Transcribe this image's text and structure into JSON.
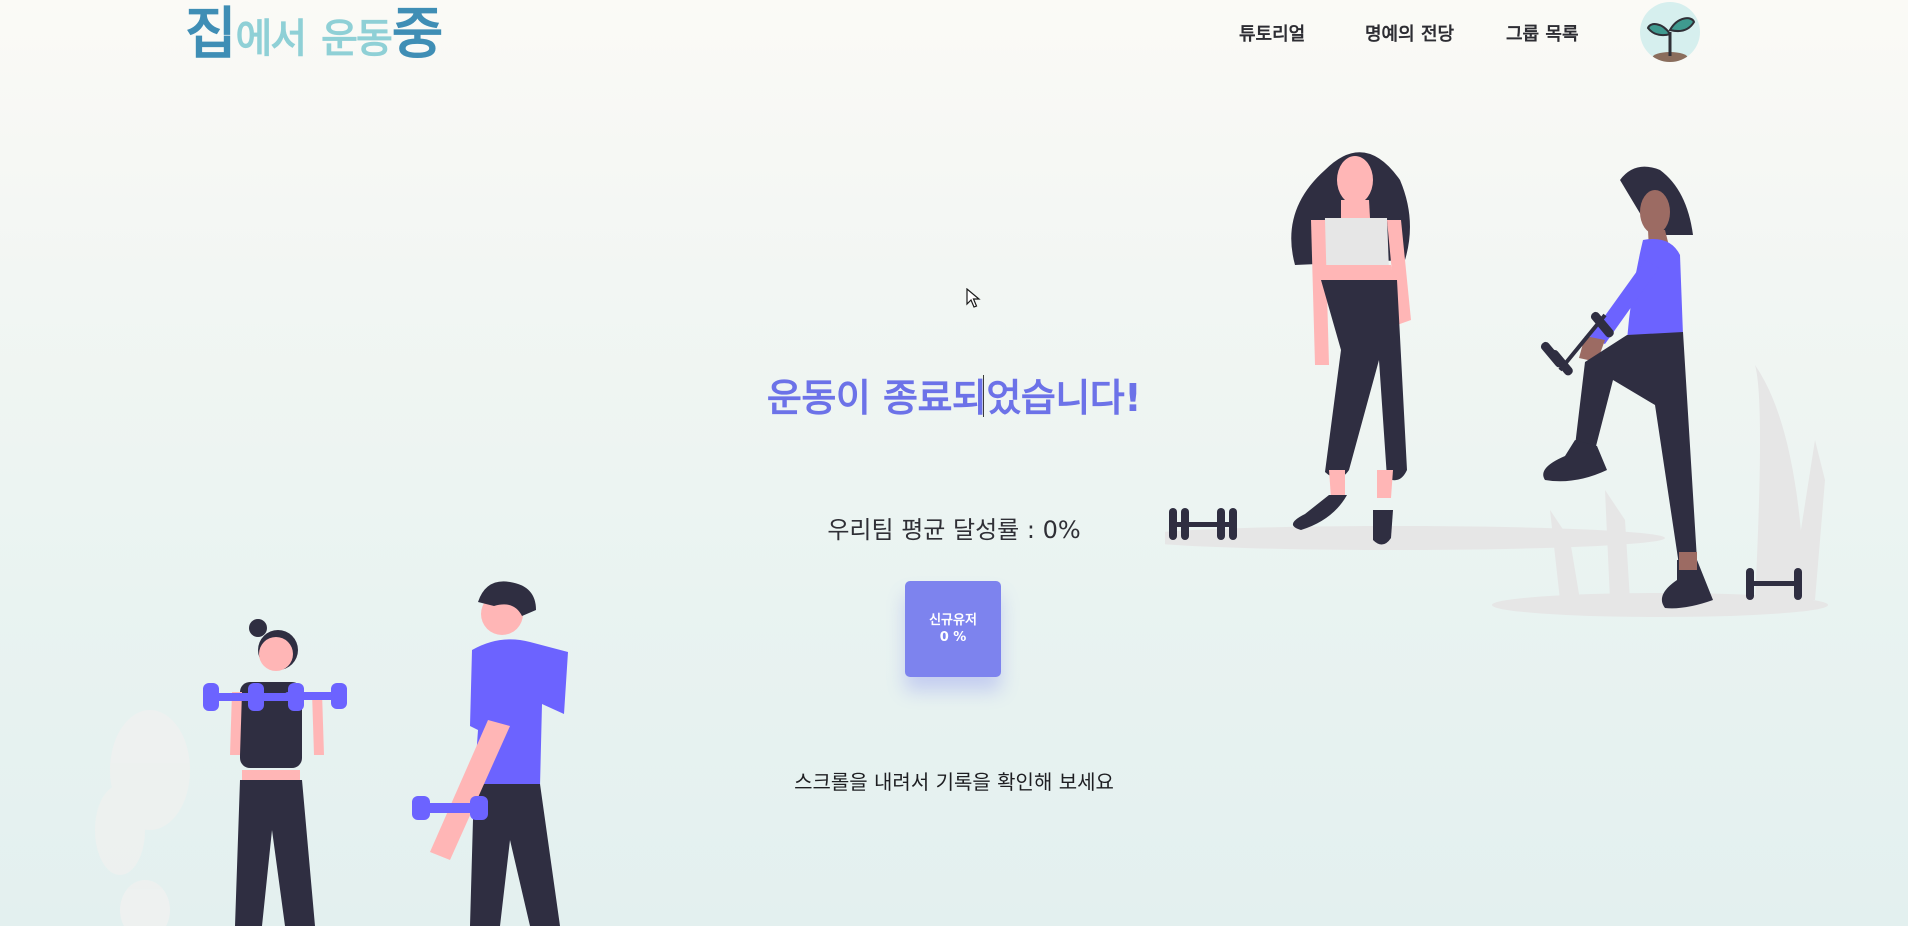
{
  "header": {
    "logo": {
      "part1": "집",
      "part2": "에서",
      "part3": "운동",
      "part4": "중"
    },
    "nav": {
      "tutorial": "튜토리얼",
      "hall_of_fame": "명예의 전당",
      "group_list": "그룹 목록"
    },
    "avatar_icon": "sprout-icon"
  },
  "main": {
    "headline": "운동이 종료되었습니다!",
    "team_average": "우리팀 평균 달성률 : 0%",
    "member_card": {
      "name": "신규유저",
      "percent": "0 %"
    },
    "scroll_hint": "스크롤을 내려서 기록을 확인해 보세요"
  },
  "colors": {
    "accent": "#6c72e8",
    "card": "#7d83ee",
    "logo_dark": "#3f8eb5",
    "logo_light": "#8fd0d6",
    "figure_dark": "#2f2e41",
    "figure_purple": "#6c63ff",
    "skin": "#ffb6b6"
  }
}
